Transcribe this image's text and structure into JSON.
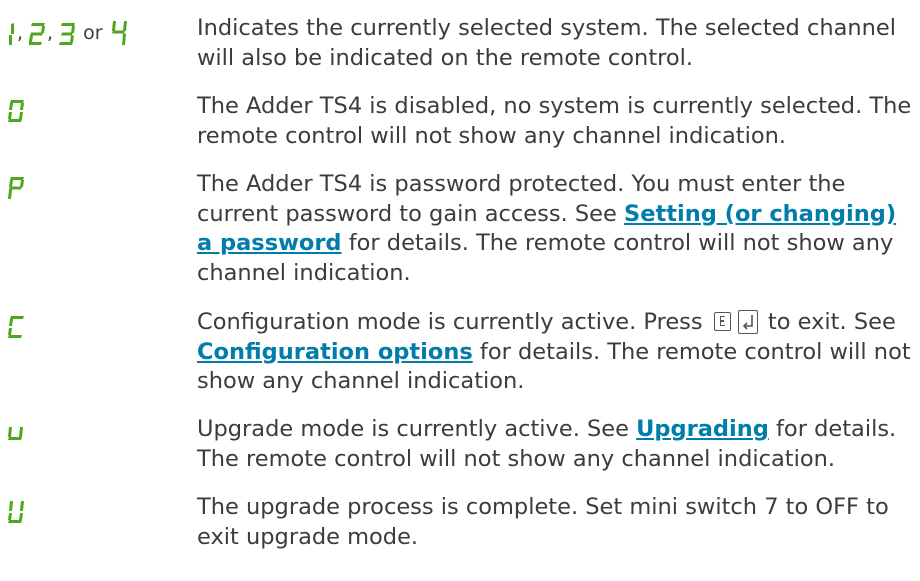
{
  "rows": [
    {
      "code": "1, 2, 3 or 4",
      "codes": [
        "1",
        "2",
        "3",
        "4"
      ],
      "code_sep_comma": ",",
      "code_sep_or": "or",
      "text": "Indicates the currently selected system. The selected channel will also be indicated on the remote control."
    },
    {
      "code": "0",
      "text": "The Adder TS4 is disabled, no system is currently selected. The remote control will not show any channel indication."
    },
    {
      "code": "P",
      "text_before": "The Adder TS4 is password protected. You must enter the current password to gain access. See ",
      "link": "Setting (or changing) a password",
      "text_after": " for details. The remote control will not show any channel indication."
    },
    {
      "code": "C",
      "text_before": "Configuration mode is currently active. Press ",
      "keys": [
        "E-key-icon",
        "enter-key-icon"
      ],
      "text_mid": " to exit. See ",
      "link": "Configuration options",
      "text_after": " for details. The remote control will not show any channel indication."
    },
    {
      "code": "u",
      "text_before": "Upgrade mode is currently active. See ",
      "link": "Upgrading",
      "text_after": " for details. The remote control will not show any channel indication."
    },
    {
      "code": "U",
      "text": "The upgrade process is complete. Set mini switch 7 to OFF to exit upgrade mode."
    }
  ],
  "colors": {
    "segment_green": "#4fa71e",
    "link_blue": "#007dab",
    "body_text": "#3c3c3c"
  }
}
